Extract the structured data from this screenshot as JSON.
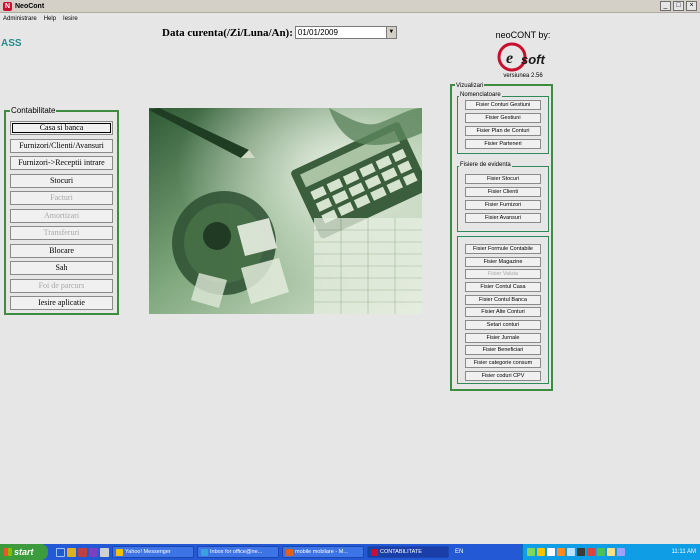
{
  "window": {
    "title": "NeoCont",
    "controls": [
      "_",
      "□",
      "×"
    ]
  },
  "menu": {
    "items": [
      "Administrare",
      "Help",
      "Iesire"
    ]
  },
  "app_label": "ASS",
  "date": {
    "label": "Data curenta(/Zi/Luna/An):",
    "value": "01/01/2009"
  },
  "brand": {
    "text": "neoCONT  by:",
    "version": "versiunea 2.56",
    "logo_text": "soft",
    "logo_letter": "e"
  },
  "contabilitate": {
    "title": "Contabilitate",
    "buttons": [
      {
        "label": "Casa si banca",
        "enabled": true
      },
      {
        "label": "Furnizori/Clienti/Avansuri",
        "enabled": true
      },
      {
        "label": "Furnizori->Receptii intrare",
        "enabled": true
      },
      {
        "label": "Stocuri",
        "enabled": true
      },
      {
        "label": "Facturi",
        "enabled": false
      },
      {
        "label": "Amortizari",
        "enabled": false
      },
      {
        "label": "Transferuri",
        "enabled": false
      },
      {
        "label": "Blocare",
        "enabled": true
      },
      {
        "label": "Sah",
        "enabled": true
      },
      {
        "label": "Foi de parcurs",
        "enabled": false
      },
      {
        "label": "Iesire aplicatie",
        "enabled": true
      }
    ]
  },
  "vizualizari": {
    "title": "Vizualizari",
    "nomenclatoare": {
      "title": "Nomenclatoare",
      "buttons": [
        "Fisier Conturi Gestiuni",
        "Fisier Gestiuni",
        "Fisier Plan de Conturi",
        "Fisier Parteneri"
      ]
    },
    "fisiere_evidenta": {
      "title": "Fisiere de evidenta",
      "buttons": [
        "Fisier Stocuri",
        "Fisier Clienti",
        "Fisier Furnizori",
        "Fisier Avansuri"
      ]
    },
    "other_buttons": [
      {
        "label": "Fisier Formule Contabile",
        "enabled": true
      },
      {
        "label": "Fisier Magazine",
        "enabled": true
      },
      {
        "label": "Fisier Valuta",
        "enabled": false
      },
      {
        "label": "Fisier Contul Casa",
        "enabled": true
      },
      {
        "label": "Fisier Contul Banca",
        "enabled": true
      },
      {
        "label": "Fisier Alte Conturi",
        "enabled": true
      },
      {
        "label": "Setari conturi",
        "enabled": true
      },
      {
        "label": "Fisier Jurnale",
        "enabled": true
      },
      {
        "label": "Fisier Beneficiari",
        "enabled": true
      },
      {
        "label": "Fisier categorie consum",
        "enabled": true
      },
      {
        "label": "Fisier coduri CPV",
        "enabled": true
      }
    ]
  },
  "taskbar": {
    "start": "start",
    "tasks": [
      {
        "label": "Yahoo! Messenger",
        "active": false
      },
      {
        "label": "Inbox for office@ne...",
        "active": false
      },
      {
        "label": "mobile mobilare - M...",
        "active": false
      },
      {
        "label": "CONTABILITATE",
        "active": true
      }
    ],
    "language": "EN",
    "clock": "11:11 AM"
  },
  "colors": {
    "panel_border": "#3e8c3e",
    "app_label": "#2a8a8a",
    "taskbar": "#2459d6",
    "tray": "#0f9ee6",
    "start": "#3c9b3c"
  }
}
